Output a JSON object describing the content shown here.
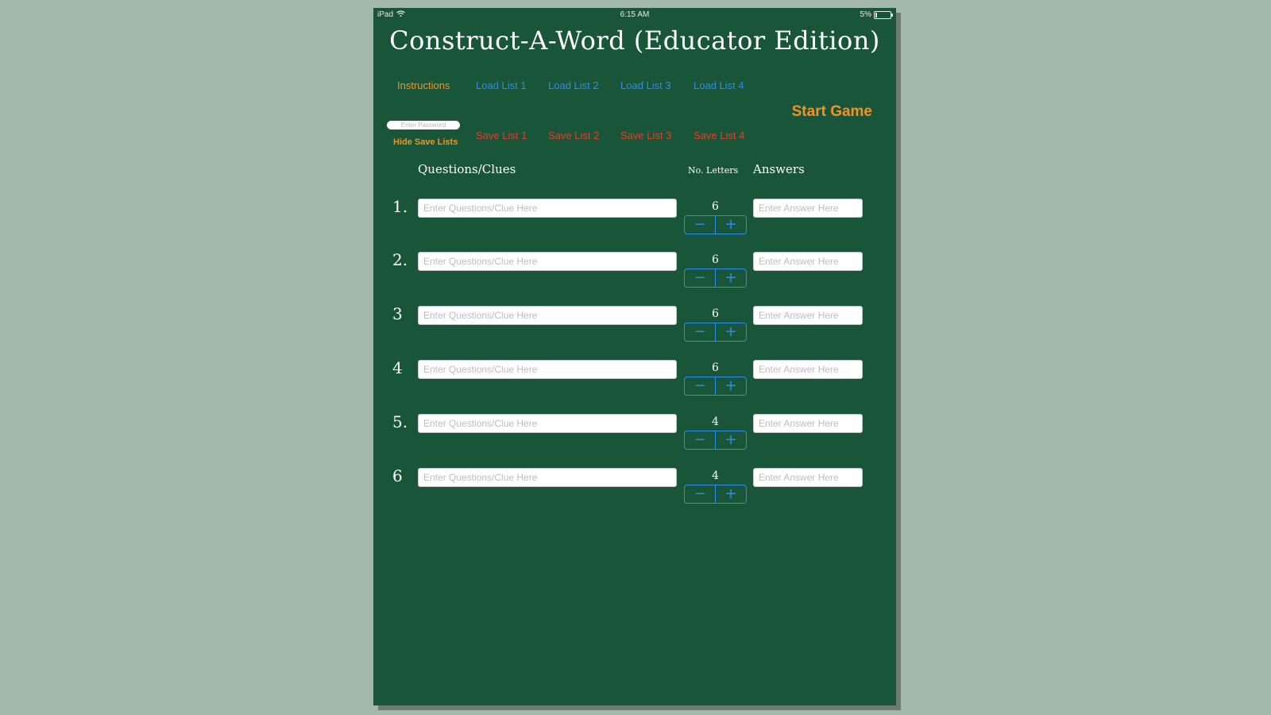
{
  "status_bar": {
    "device": "iPad",
    "time": "6:15 AM",
    "battery": "5%"
  },
  "title": "Construct-A-Word (Educator Edition)",
  "top_links": {
    "instructions": "Instructions",
    "load": [
      "Load List 1",
      "Load List 2",
      "Load List 3",
      "Load List 4"
    ],
    "save": [
      "Save List 1",
      "Save List 2",
      "Save List 3",
      "Save List 4"
    ],
    "start_game": "Start Game",
    "hide_save_lists": "Hide Save Lists"
  },
  "password": {
    "placeholder": "Enter Password",
    "value": ""
  },
  "columns": {
    "questions": "Questions/Clues",
    "letters": "No. Letters",
    "answers": "Answers"
  },
  "stepper": {
    "minus": "−",
    "plus": "+"
  },
  "rows": [
    {
      "number": "1.",
      "question_placeholder": "Enter Questions/Clue Here",
      "letters": "6",
      "answer_placeholder": "Enter Answer Here"
    },
    {
      "number": "2.",
      "question_placeholder": "Enter Questions/Clue Here",
      "letters": "6",
      "answer_placeholder": "Enter Answer Here"
    },
    {
      "number": "3",
      "question_placeholder": "Enter Questions/Clue Here",
      "letters": "6",
      "answer_placeholder": "Enter Answer Here"
    },
    {
      "number": "4",
      "question_placeholder": "Enter Questions/Clue Here",
      "letters": "6",
      "answer_placeholder": "Enter Answer Here"
    },
    {
      "number": "5.",
      "question_placeholder": "Enter Questions/Clue Here",
      "letters": "4",
      "answer_placeholder": "Enter Answer Here"
    },
    {
      "number": "6",
      "question_placeholder": "Enter Questions/Clue Here",
      "letters": "4",
      "answer_placeholder": "Enter Answer Here"
    }
  ],
  "colors": {
    "board": "#195538",
    "background": "#a2b8a9",
    "orange": "#f0932a",
    "blue": "#2b8ee8",
    "red": "#e0412f"
  }
}
